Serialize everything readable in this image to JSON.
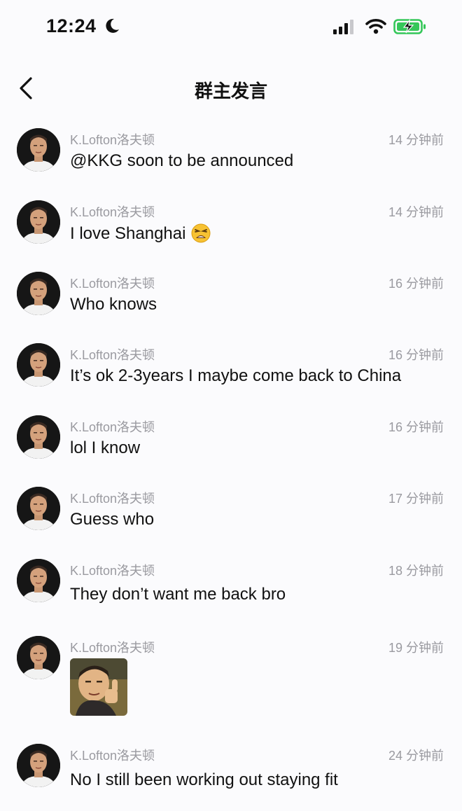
{
  "status": {
    "time": "12:24"
  },
  "header": {
    "title": "群主发言"
  },
  "messages": [
    {
      "name": "K.Lofton洛夫顿",
      "time": "14 分钟前",
      "text": "@KKG soon to be announced"
    },
    {
      "name": "K.Lofton洛夫顿",
      "time": "14 分钟前",
      "text": "I love Shanghai",
      "emoji": "weary-face-emoji"
    },
    {
      "name": "K.Lofton洛夫顿",
      "time": "16 分钟前",
      "text": "Who knows"
    },
    {
      "name": "K.Lofton洛夫顿",
      "time": "16 分钟前",
      "text": "It’s ok 2-3years I maybe come back to China"
    },
    {
      "name": "K.Lofton洛夫顿",
      "time": "16 分钟前",
      "text": "lol I know"
    },
    {
      "name": "K.Lofton洛夫顿",
      "time": "17 分钟前",
      "text": "Guess who"
    },
    {
      "name": "K.Lofton洛夫顿",
      "time": "18 分钟前",
      "text": "They don’t want me back bro"
    },
    {
      "name": "K.Lofton洛夫顿",
      "time": "19 分钟前",
      "sticker": "thumbs-up-sticker"
    },
    {
      "name": "K.Lofton洛夫顿",
      "time": "24 分钟前",
      "text": "No I still been working out staying fit"
    }
  ],
  "colors": {
    "background": "#fbfbfd",
    "meta_text": "#9a9aa0",
    "battery_green": "#35c759"
  }
}
